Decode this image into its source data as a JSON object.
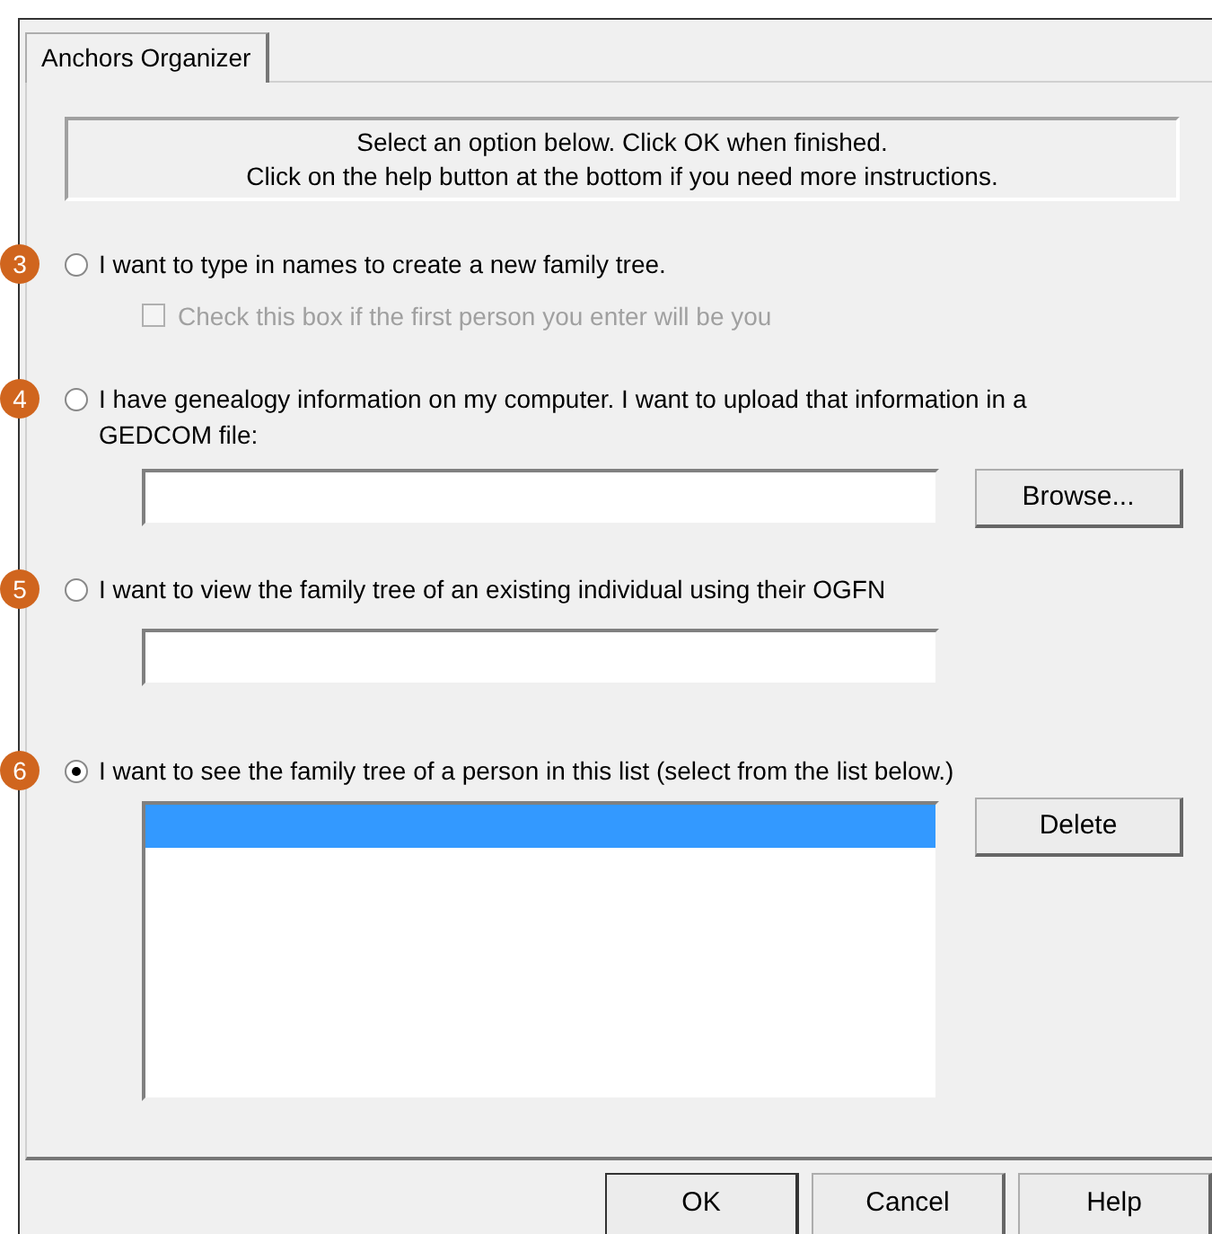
{
  "tabs": [
    {
      "label": "Anchors Organizer",
      "selected": true
    }
  ],
  "instructions": [
    "Select an option below. Click OK when finished.",
    "Click on the help button at the bottom if you need more instructions."
  ],
  "options": [
    {
      "step": "3",
      "label": "I want to type in names to create a new family tree.",
      "selected": false,
      "kind": "checkbox",
      "checkbox": {
        "label": "Check this box if the first person you enter will be you",
        "checked": false,
        "disabled": true
      }
    },
    {
      "step": "4",
      "label": "I have genealogy information on my computer. I want to upload that information in a GEDCOM file:",
      "selected": false,
      "kind": "file",
      "button": "Browse..."
    },
    {
      "step": "5",
      "label": "I want to view the family tree of an existing individual using their OGFN",
      "selected": false,
      "kind": "text"
    },
    {
      "step": "6",
      "label": "I want to see the family tree of a person in this list (select from the list below.)",
      "selected": true,
      "kind": "list",
      "rows": [
        {
          "selected": true
        }
      ],
      "button": "Delete"
    }
  ],
  "buttons": [
    "OK",
    "Cancel",
    "Help"
  ]
}
